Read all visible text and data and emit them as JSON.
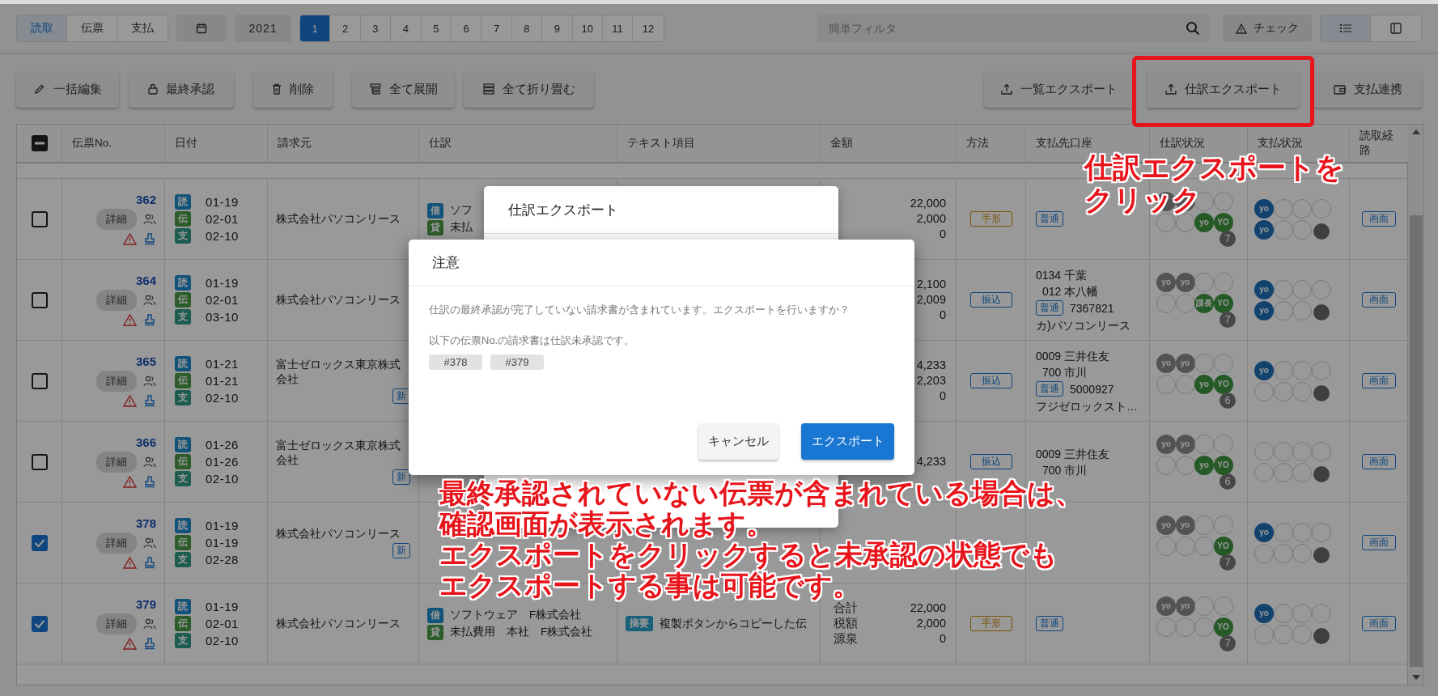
{
  "toolbar": {
    "view_tabs": [
      {
        "label": "読取",
        "selected": true
      },
      {
        "label": "伝票",
        "selected": false
      },
      {
        "label": "支払",
        "selected": false
      }
    ],
    "year": "2021",
    "months": [
      {
        "label": "1",
        "selected": true
      },
      {
        "label": "2",
        "selected": false
      },
      {
        "label": "3",
        "selected": false
      },
      {
        "label": "4",
        "selected": false
      },
      {
        "label": "5",
        "selected": false
      },
      {
        "label": "6",
        "selected": false
      },
      {
        "label": "7",
        "selected": false
      },
      {
        "label": "8",
        "selected": false
      },
      {
        "label": "9",
        "selected": false
      },
      {
        "label": "10",
        "selected": false
      },
      {
        "label": "11",
        "selected": false
      },
      {
        "label": "12",
        "selected": false
      }
    ],
    "search": {
      "placeholder": "簡単フィルタ"
    },
    "check_button": "チェック",
    "layout_toggle": [
      {
        "kind": "list",
        "selected": true
      },
      {
        "kind": "panel",
        "selected": false
      }
    ]
  },
  "actions": {
    "left": [
      {
        "label": "一括編集",
        "kind": "edit"
      },
      {
        "label": "最終承認",
        "kind": "lock"
      },
      {
        "label": "削除",
        "kind": "delete"
      },
      {
        "label": "全て展開",
        "kind": "expand"
      },
      {
        "label": "全て折り畳む",
        "kind": "collapse"
      }
    ],
    "right": [
      {
        "label": "一覧エクスポート",
        "kind": "export",
        "highlighted": false
      },
      {
        "label": "仕訳エクスポート",
        "kind": "export",
        "highlighted": true
      },
      {
        "label": "支払連携",
        "kind": "wallet",
        "highlighted": false
      }
    ]
  },
  "table": {
    "select_all": {
      "partial": true
    },
    "columns": [
      "伝票No.",
      "日付",
      "請求元",
      "仕訳",
      "テキスト項目",
      "金額",
      "方法",
      "支払先口座",
      "仕訳状況",
      "支払状況",
      "読取経路"
    ],
    "rows": [
      {
        "checked": false,
        "number": "362",
        "detail": "詳細",
        "dates": [
          {
            "kind": "read",
            "tag": "読",
            "date": "01-19"
          },
          {
            "kind": "voucher",
            "tag": "伝",
            "date": "02-01"
          },
          {
            "kind": "pay",
            "tag": "支",
            "date": "02-10"
          }
        ],
        "vendor": "株式会社パソコンリース",
        "journal": [
          {
            "kind": "debit",
            "tag": "借",
            "text": "ソフ"
          },
          {
            "kind": "credit",
            "tag": "貸",
            "text": "未払"
          }
        ],
        "amounts": [
          {
            "value": "22,000"
          },
          {
            "value": "2,000"
          },
          {
            "value": "0"
          }
        ],
        "method": {
          "kind": "bill",
          "label": "手形"
        },
        "account": {
          "type": "普通"
        },
        "journal_status": {
          "top": [
            {
              "kind": "grey"
            },
            {
              "kind": "grey"
            },
            {
              "kind": "empty"
            },
            {
              "kind": "empty"
            }
          ],
          "bottom": [
            {
              "kind": "empty"
            },
            {
              "kind": "empty"
            },
            {
              "kind": "green",
              "label": "yo"
            },
            {
              "kind": "green",
              "label": "YO"
            }
          ],
          "count": "7"
        },
        "payment_status": {
          "top": [
            {
              "kind": "blue",
              "label": "yo"
            },
            {
              "kind": "empty"
            },
            {
              "kind": "empty"
            },
            {
              "kind": "empty"
            }
          ],
          "bottom": [
            {
              "kind": "blue",
              "label": "yo"
            },
            {
              "kind": "empty"
            },
            {
              "kind": "empty"
            },
            {
              "kind": "dot"
            }
          ]
        },
        "route": "画面"
      },
      {
        "checked": false,
        "number": "364",
        "detail": "詳細",
        "dates": [
          {
            "kind": "read",
            "tag": "読",
            "date": "01-19"
          },
          {
            "kind": "voucher",
            "tag": "伝",
            "date": "02-01"
          },
          {
            "kind": "pay",
            "tag": "支",
            "date": "03-10"
          }
        ],
        "vendor": "株式会社パソコンリース",
        "amounts": [
          {
            "value": "2,100"
          },
          {
            "value": "2,009"
          },
          {
            "value": "0"
          }
        ],
        "method": {
          "kind": "transfer",
          "label": "振込"
        },
        "account": {
          "lines": [
            "0134 千葉",
            "012 本八幡"
          ],
          "type": "普通",
          "number": "7367821",
          "holder": "カ)パソコンリース"
        },
        "journal_status": {
          "top": [
            {
              "kind": "grey",
              "label": "yo"
            },
            {
              "kind": "grey",
              "label": "yo"
            },
            {
              "kind": "empty"
            },
            {
              "kind": "empty"
            }
          ],
          "bottom": [
            {
              "kind": "empty"
            },
            {
              "kind": "empty"
            },
            {
              "kind": "green",
              "label": "課長"
            },
            {
              "kind": "green",
              "label": "YO"
            }
          ],
          "count": "7"
        },
        "payment_status": {
          "top": [
            {
              "kind": "blue",
              "label": "yo"
            },
            {
              "kind": "empty"
            },
            {
              "kind": "empty"
            },
            {
              "kind": "empty"
            }
          ],
          "bottom": [
            {
              "kind": "blue",
              "label": "yo"
            },
            {
              "kind": "empty"
            },
            {
              "kind": "empty"
            },
            {
              "kind": "dot"
            }
          ]
        },
        "route": "画面"
      },
      {
        "checked": false,
        "number": "365",
        "detail": "詳細",
        "dates": [
          {
            "kind": "read",
            "tag": "読",
            "date": "01-21"
          },
          {
            "kind": "voucher",
            "tag": "伝",
            "date": "01-21"
          },
          {
            "kind": "pay",
            "tag": "支",
            "date": "02-10"
          }
        ],
        "vendor": "富士ゼロックス東京株式会社",
        "new_tag": "新",
        "amounts": [
          {
            "value": "4,233"
          },
          {
            "value": "2,203"
          },
          {
            "value": "0"
          }
        ],
        "method": {
          "kind": "transfer",
          "label": "振込"
        },
        "account": {
          "lines": [
            "0009 三井住友",
            "700 市川"
          ],
          "type": "普通",
          "number": "5000927",
          "holder": "フジゼロックスト…"
        },
        "journal_status": {
          "top": [
            {
              "kind": "grey",
              "label": "yo"
            },
            {
              "kind": "grey",
              "label": "yo"
            },
            {
              "kind": "empty"
            },
            {
              "kind": "empty"
            }
          ],
          "bottom": [
            {
              "kind": "empty"
            },
            {
              "kind": "empty"
            },
            {
              "kind": "green",
              "label": "yo"
            },
            {
              "kind": "green",
              "label": "YO"
            }
          ],
          "count": "6"
        },
        "payment_status": {
          "top": [
            {
              "kind": "blue",
              "label": "yo"
            },
            {
              "kind": "empty"
            },
            {
              "kind": "empty"
            },
            {
              "kind": "empty"
            }
          ],
          "bottom": [
            {
              "kind": "empty"
            },
            {
              "kind": "empty"
            },
            {
              "kind": "empty"
            },
            {
              "kind": "dot"
            }
          ]
        },
        "route": "画面"
      },
      {
        "checked": false,
        "number": "366",
        "detail": "詳細",
        "dates": [
          {
            "kind": "read",
            "tag": "読",
            "date": "01-26"
          },
          {
            "kind": "voucher",
            "tag": "伝",
            "date": "01-26"
          },
          {
            "kind": "pay",
            "tag": "支",
            "date": "02-10"
          }
        ],
        "vendor": "富士ゼロックス東京株式会社",
        "new_tag": "新",
        "amounts": [
          {
            "value": "4,233"
          }
        ],
        "method": {
          "kind": "transfer",
          "label": "振込"
        },
        "account": {
          "lines": [
            "0009 三井住友",
            "700 市川"
          ]
        },
        "journal_status": {
          "top": [
            {
              "kind": "grey",
              "label": "yo"
            },
            {
              "kind": "grey",
              "label": "yo"
            },
            {
              "kind": "empty"
            },
            {
              "kind": "empty"
            }
          ],
          "bottom": [
            {
              "kind": "empty"
            },
            {
              "kind": "empty"
            },
            {
              "kind": "green",
              "label": "yo"
            },
            {
              "kind": "green",
              "label": "YO"
            }
          ],
          "count": "6"
        },
        "payment_status": {
          "top": [
            {
              "kind": "empty"
            },
            {
              "kind": "empty"
            },
            {
              "kind": "empty"
            },
            {
              "kind": "empty"
            }
          ],
          "bottom": [
            {
              "kind": "empty"
            },
            {
              "kind": "empty"
            },
            {
              "kind": "empty"
            },
            {
              "kind": "dot"
            }
          ]
        },
        "route": "画面"
      },
      {
        "checked": true,
        "number": "378",
        "detail": "詳細",
        "dates": [
          {
            "kind": "read",
            "tag": "読",
            "date": "01-19"
          },
          {
            "kind": "voucher",
            "tag": "伝",
            "date": "01-19"
          },
          {
            "kind": "pay",
            "tag": "支",
            "date": "02-28"
          }
        ],
        "vendor": "株式会社パソコンリース",
        "new_tag": "新",
        "journal_status": {
          "top": [
            {
              "kind": "grey",
              "label": "yo"
            },
            {
              "kind": "grey",
              "label": "yo"
            },
            {
              "kind": "empty"
            },
            {
              "kind": "empty"
            }
          ],
          "bottom": [
            {
              "kind": "empty"
            },
            {
              "kind": "empty"
            },
            {
              "kind": "empty"
            },
            {
              "kind": "green",
              "label": "YO"
            }
          ],
          "count": "7"
        },
        "payment_status": {
          "top": [
            {
              "kind": "blue",
              "label": "yo"
            },
            {
              "kind": "empty"
            },
            {
              "kind": "empty"
            },
            {
              "kind": "empty"
            }
          ],
          "bottom": [
            {
              "kind": "empty"
            },
            {
              "kind": "empty"
            },
            {
              "kind": "empty"
            },
            {
              "kind": "dot"
            }
          ]
        },
        "route": "画面"
      },
      {
        "checked": true,
        "number": "379",
        "detail": "詳細",
        "dates": [
          {
            "kind": "read",
            "tag": "読",
            "date": "01-19"
          },
          {
            "kind": "voucher",
            "tag": "伝",
            "date": "02-01"
          },
          {
            "kind": "pay",
            "tag": "支",
            "date": "02-10"
          }
        ],
        "vendor": "株式会社パソコンリース",
        "journal": [
          {
            "kind": "debit",
            "tag": "借",
            "text": "ソフトウェア　F株式会社"
          },
          {
            "kind": "credit",
            "tag": "貸",
            "text": "未払費用　本社　F株式会社"
          }
        ],
        "text_item": {
          "tag": "摘要",
          "text": "複製ボタンからコピーした伝"
        },
        "amounts": [
          {
            "label": "合計",
            "value": "22,000"
          },
          {
            "label": "税額",
            "value": "2,000"
          },
          {
            "label": "源泉",
            "value": "0"
          }
        ],
        "method": {
          "kind": "bill",
          "label": "手形"
        },
        "account": {
          "type": "普通"
        },
        "journal_status": {
          "top": [
            {
              "kind": "grey",
              "label": "yo"
            },
            {
              "kind": "grey",
              "label": "yo"
            },
            {
              "kind": "empty"
            },
            {
              "kind": "empty"
            }
          ],
          "bottom": [
            {
              "kind": "empty"
            },
            {
              "kind": "empty"
            },
            {
              "kind": "empty"
            },
            {
              "kind": "green",
              "label": "YO"
            }
          ],
          "count": "7"
        },
        "payment_status": {
          "top": [
            {
              "kind": "blue",
              "label": "yo"
            },
            {
              "kind": "empty"
            },
            {
              "kind": "empty"
            },
            {
              "kind": "empty"
            }
          ],
          "bottom": [
            {
              "kind": "empty"
            },
            {
              "kind": "empty"
            },
            {
              "kind": "empty"
            },
            {
              "kind": "dot"
            }
          ]
        },
        "route": "画面"
      }
    ]
  },
  "back_dialog": {
    "title": "仕訳エクスポート"
  },
  "dialog": {
    "title": "注意",
    "message": "仕訳の最終承認が完了していない請求書が含まれています。エクスポートを行いますか？",
    "note": "以下の伝票No.の請求書は仕訳未承認です。",
    "tags": [
      "#378",
      "#379"
    ],
    "buttons": [
      {
        "kind": "secondary",
        "label": "キャンセル"
      },
      {
        "kind": "primary",
        "label": "エクスポート"
      }
    ]
  },
  "annotations": [
    {
      "kind": "top",
      "lines": [
        "仕訳エクスポートを",
        "クリック"
      ]
    },
    {
      "kind": "bottom",
      "lines": [
        "最終承認されていない伝票が含まれている場合は、",
        "確認画面が表示されます。",
        "エクスポートをクリックすると未承認の状態でも",
        "エクスポートする事は可能です。"
      ]
    }
  ]
}
